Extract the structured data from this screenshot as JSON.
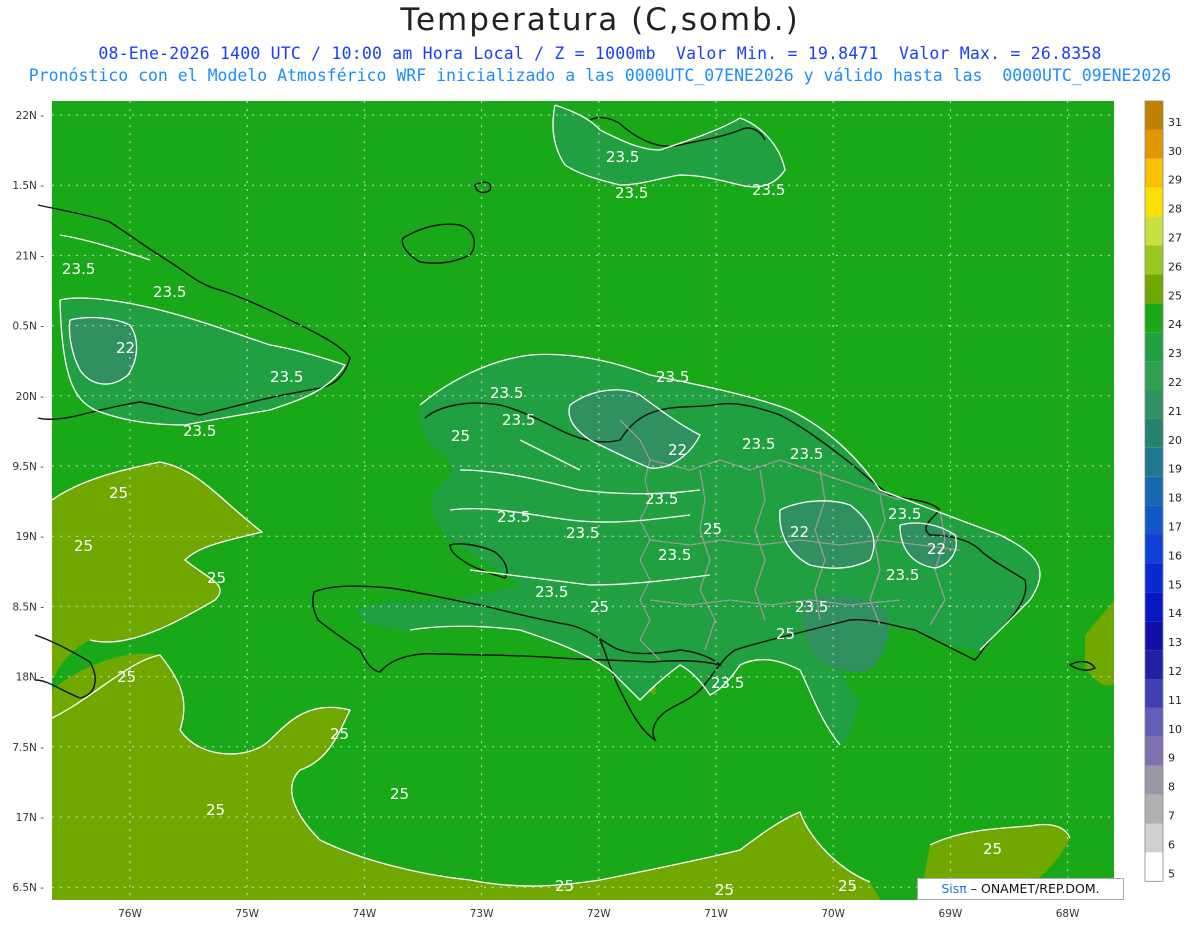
{
  "title": "Temperatura (C,somb.)",
  "subtitle_1": "08-Ene-2026 1400 UTC / 10:00 am Hora Local / Z = 1000mb  Valor Min. = 19.8471  Valor Max. = 26.8358",
  "subtitle_2": "Pronóstico con el Modelo Atmosférico WRF inicializado a las 0000UTC_07ENE2026 y válido hasta las  0000UTC_09ENE2026",
  "credit": {
    "brand": "Sisπ",
    "text": " – ONAMET/REP.DOM."
  },
  "map": {
    "lat_labels": [
      "22N",
      "1.5N",
      "21N",
      "0.5N",
      "20N",
      "9.5N",
      "19N",
      "8.5N",
      "18N",
      "7.5N",
      "17N",
      "6.5N"
    ],
    "lon_labels": [
      "76W",
      "75W",
      "74W",
      "73W",
      "72W",
      "71W",
      "70W",
      "69W",
      "68W"
    ],
    "contour_labels": [
      "23.5",
      "23.5",
      "23.5",
      "23.5",
      "22",
      "23.5",
      "23.5",
      "25",
      "23.5",
      "23.5",
      "23.5",
      "25",
      "25",
      "22",
      "23.5",
      "23.5",
      "23.5",
      "23.5",
      "23.5",
      "22",
      "23.5",
      "25",
      "23.5",
      "22",
      "23.5",
      "23.5",
      "25",
      "23.5",
      "25",
      "25",
      "25",
      "25",
      "25",
      "25",
      "25",
      "25",
      "25",
      "23.5",
      "25",
      "23.5",
      "25"
    ]
  },
  "colorbar": {
    "levels": [
      "31",
      "30",
      "29",
      "28",
      "27",
      "26",
      "25",
      "24",
      "23",
      "22",
      "21",
      "20",
      "19",
      "18",
      "17",
      "16",
      "15",
      "14",
      "13",
      "12",
      "11",
      "10",
      "9",
      "8",
      "7",
      "6",
      "5"
    ],
    "colors": [
      "#c08000",
      "#e09800",
      "#f8c000",
      "#f8e000",
      "#c8e040",
      "#98c820",
      "#70a800",
      "#18a818",
      "#20a040",
      "#30a050",
      "#309060",
      "#288070",
      "#207890",
      "#1868b0",
      "#1458c8",
      "#1040d8",
      "#0a28d0",
      "#0818c0",
      "#1010a8",
      "#2020a0",
      "#4040b0",
      "#6060b8",
      "#8070b0",
      "#9898a8",
      "#b0b0b0",
      "#d0d0d0",
      "#ffffff"
    ]
  }
}
